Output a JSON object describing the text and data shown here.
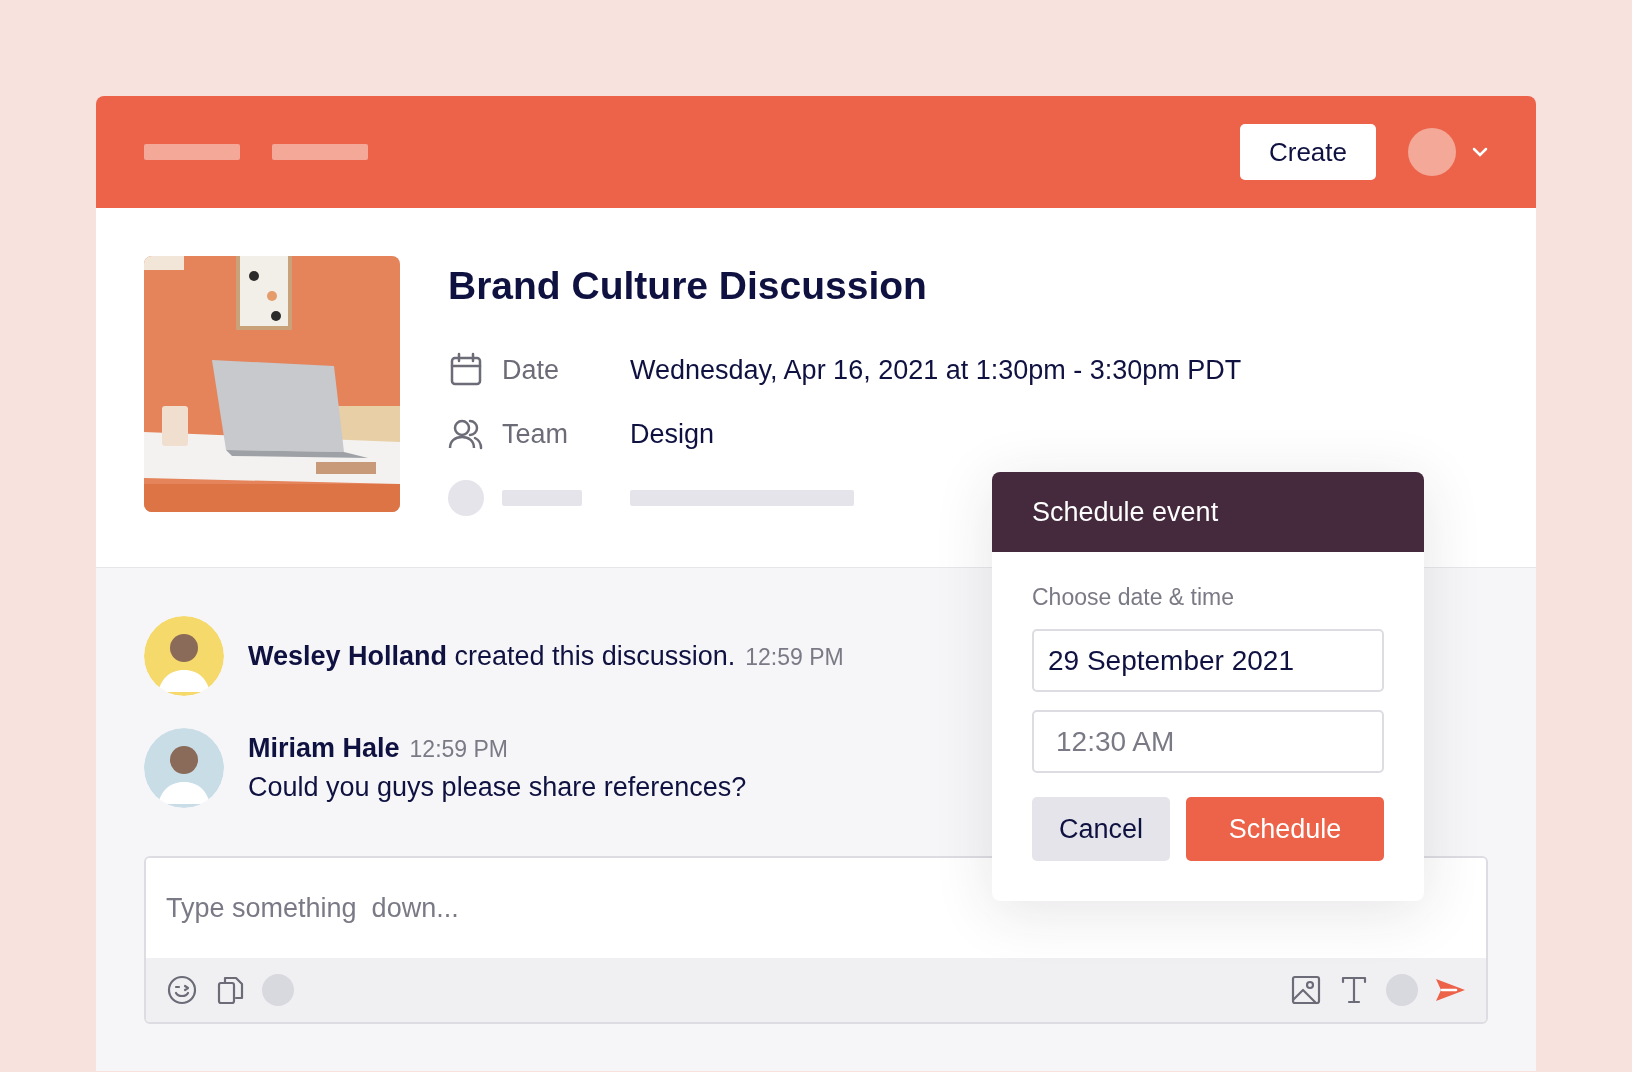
{
  "header": {
    "create_button": "Create"
  },
  "event": {
    "title": "Brand Culture Discussion",
    "details": [
      {
        "kind": "date",
        "label": "Date",
        "value": "Wednesday, Apr 16, 2021 at 1:30pm - 3:30pm PDT"
      },
      {
        "kind": "team",
        "label": "Team",
        "value": "Design"
      }
    ]
  },
  "messages": [
    {
      "kind": "activity",
      "text": "**Wesley Holland** created this discussion.",
      "time": "12:59 PM"
    },
    {
      "kind": "comment",
      "author": "Miriam Hale",
      "time": "12:59 PM",
      "text": "Could you guys please share references?"
    }
  ],
  "composer": {
    "placeholder": "Type something  down..."
  },
  "dialog": {
    "title": "Schedule event",
    "label": "Choose date & time",
    "date_value": "29 September 2021",
    "time_placeholder": "12:30 AM",
    "buttons": [
      {
        "kind": "secondary",
        "label": "Cancel"
      },
      {
        "kind": "primary",
        "label": "Schedule"
      }
    ]
  }
}
